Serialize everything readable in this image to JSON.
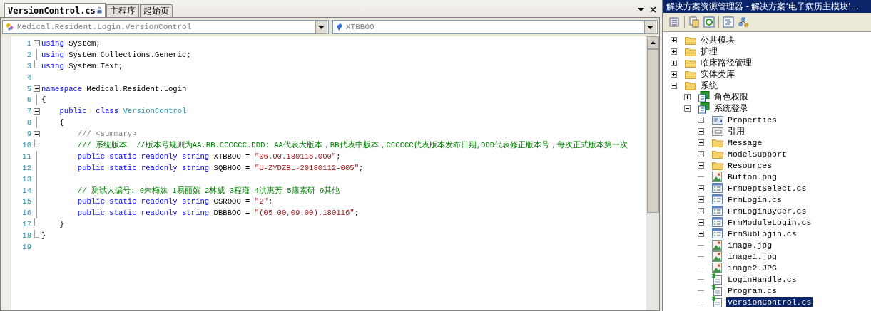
{
  "tabs": [
    {
      "label": "VersionControl.cs",
      "selected": true,
      "locked": true
    },
    {
      "label": "主程序",
      "selected": false,
      "locked": false
    },
    {
      "label": "起始页",
      "selected": false,
      "locked": false
    }
  ],
  "type_dropdown": {
    "value": "Medical.Resident.Login.VersionControl"
  },
  "member_dropdown": {
    "value": "XTBBOO"
  },
  "code_lines": [
    {
      "number": "1",
      "kind": "fold-start",
      "tokens": [
        {
          "kind": "kw",
          "text": "using"
        },
        {
          "kind": "plain",
          "text": " System;"
        }
      ]
    },
    {
      "number": "2",
      "kind": "fold-line",
      "tokens": [
        {
          "kind": "kw",
          "text": "using"
        },
        {
          "kind": "plain",
          "text": " System.Collections.Generic;"
        }
      ]
    },
    {
      "number": "3",
      "kind": "fold-end",
      "tokens": [
        {
          "kind": "kw",
          "text": "using"
        },
        {
          "kind": "plain",
          "text": " System.Text;"
        }
      ]
    },
    {
      "number": "4",
      "kind": "plain"
    },
    {
      "number": "5",
      "kind": "fold-start",
      "tokens": [
        {
          "kind": "kw",
          "text": "namespace"
        },
        {
          "kind": "plain",
          "text": " Medical.Resident.Login"
        }
      ]
    },
    {
      "number": "6",
      "kind": "fold-line",
      "tokens": [
        {
          "kind": "plain",
          "text": "{"
        }
      ]
    },
    {
      "number": "7",
      "kind": "fold-start",
      "tokens": [
        {
          "kind": "kw",
          "text": "    public  class"
        },
        {
          "kind": "type",
          "text": " VersionControl"
        }
      ]
    },
    {
      "number": "8",
      "kind": "fold-line",
      "tokens": [
        {
          "kind": "plain",
          "text": "    {"
        }
      ]
    },
    {
      "number": "9",
      "kind": "fold-start",
      "tokens": [
        {
          "kind": "doc",
          "text": "        /// <summary>"
        }
      ]
    },
    {
      "number": "10",
      "kind": "fold-end",
      "tokens": [
        {
          "kind": "comment",
          "text": "        /// 系统版本  //版本号规则为AA.BB.CCCCCC.DDD: AA代表大版本，BB代表中版本，CCCCCC代表版本发布日期,DDD代表修正版本号，每次正式版本第一次"
        }
      ]
    },
    {
      "number": "11",
      "kind": "fold-line",
      "tokens": [
        {
          "kind": "kw",
          "text": "        public static readonly string"
        },
        {
          "kind": "plain",
          "text": " XTBBOO ="
        },
        {
          "kind": "str",
          "text": " \"06.00.180116.000\""
        },
        {
          "kind": "plain",
          "text": ";"
        }
      ]
    },
    {
      "number": "12",
      "kind": "fold-line",
      "tokens": [
        {
          "kind": "kw",
          "text": "        public static readonly string"
        },
        {
          "kind": "plain",
          "text": " SQBHOO ="
        },
        {
          "kind": "str",
          "text": " \"U-ZYDZBL-20180112-005\""
        },
        {
          "kind": "plain",
          "text": ";"
        }
      ]
    },
    {
      "number": "13",
      "kind": "fold-line"
    },
    {
      "number": "14",
      "kind": "fold-line",
      "tokens": [
        {
          "kind": "comment",
          "text": "        // 测试人编号: 0朱梅妹 1易丽嫔 2林威 3程瑾 4洪惠芳 5康素研 9其他"
        }
      ]
    },
    {
      "number": "15",
      "kind": "fold-line",
      "tokens": [
        {
          "kind": "kw",
          "text": "        public static readonly string"
        },
        {
          "kind": "plain",
          "text": " CSROOO ="
        },
        {
          "kind": "str",
          "text": " \"2\""
        },
        {
          "kind": "plain",
          "text": ";"
        }
      ]
    },
    {
      "number": "16",
      "kind": "fold-line",
      "tokens": [
        {
          "kind": "kw",
          "text": "        public static readonly string"
        },
        {
          "kind": "plain",
          "text": " DBBBOO ="
        },
        {
          "kind": "str",
          "text": " \"(05.00,09.00).180116\""
        },
        {
          "kind": "plain",
          "text": ";"
        }
      ]
    },
    {
      "number": "17",
      "kind": "fold-end",
      "tokens": [
        {
          "kind": "plain",
          "text": "    }"
        }
      ]
    },
    {
      "number": "18",
      "kind": "fold-end",
      "tokens": [
        {
          "kind": "plain",
          "text": "}"
        }
      ]
    },
    {
      "number": "19",
      "kind": "plain"
    }
  ],
  "solution_explorer": {
    "title": "解决方案资源管理器 - 解决方案‘电子病历主模块’...",
    "tree": [
      {
        "label": "公共模块",
        "kind": "folder",
        "expanded": false,
        "selected": false
      },
      {
        "label": "护理",
        "kind": "folder",
        "expanded": false,
        "selected": false
      },
      {
        "label": "临床路径管理",
        "kind": "folder",
        "expanded": false,
        "selected": false
      },
      {
        "label": "实体类库",
        "kind": "folder",
        "expanded": false,
        "selected": false
      },
      {
        "label": "系统",
        "kind": "folder-open",
        "expanded": true,
        "selected": false,
        "children": [
          {
            "label": "角色权限",
            "kind": "project",
            "expanded": false,
            "selected": false
          },
          {
            "label": "系统登录",
            "kind": "project",
            "expanded": true,
            "selected": false,
            "children": [
              {
                "label": "Properties",
                "kind": "properties",
                "expanded": false,
                "selected": false
              },
              {
                "label": "引用",
                "kind": "references",
                "expanded": false,
                "selected": false
              },
              {
                "label": "Message",
                "kind": "folder",
                "expanded": false,
                "selected": false
              },
              {
                "label": "ModelSupport",
                "kind": "folder",
                "expanded": false,
                "selected": false
              },
              {
                "label": "Resources",
                "kind": "folder",
                "expanded": false,
                "selected": false
              },
              {
                "label": "Button.png",
                "kind": "image",
                "selected": false
              },
              {
                "label": "FrmDeptSelect.cs",
                "kind": "form",
                "expanded": false,
                "selected": false
              },
              {
                "label": "FrmLogin.cs",
                "kind": "form",
                "expanded": false,
                "selected": false
              },
              {
                "label": "FrmLoginByCer.cs",
                "kind": "form",
                "expanded": false,
                "selected": false
              },
              {
                "label": "FrmModuleLogin.cs",
                "kind": "form",
                "expanded": false,
                "selected": false
              },
              {
                "label": "FrmSubLogin.cs",
                "kind": "form",
                "expanded": false,
                "selected": false
              },
              {
                "label": "image.jpg",
                "kind": "image",
                "selected": false
              },
              {
                "label": "image1.jpg",
                "kind": "image",
                "selected": false
              },
              {
                "label": "image2.JPG",
                "kind": "image",
                "selected": false
              },
              {
                "label": "LoginHandle.cs",
                "kind": "csfile",
                "selected": false
              },
              {
                "label": "Program.cs",
                "kind": "csfile",
                "selected": false
              },
              {
                "label": "VersionControl.cs",
                "kind": "csfile",
                "selected": true
              }
            ]
          }
        ]
      }
    ]
  }
}
